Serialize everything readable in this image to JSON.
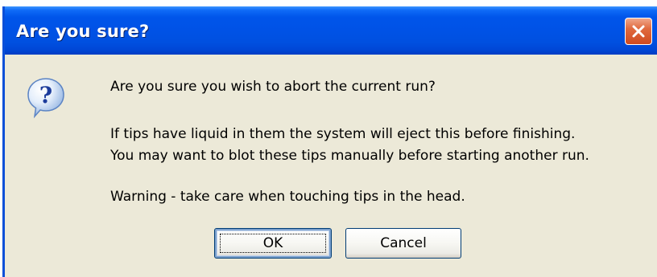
{
  "dialog": {
    "title": "Are you sure?",
    "icon": "question-icon",
    "question": "Are you sure you wish to abort the current run?",
    "info_line_1": "If tips have liquid in them the system will eject this before finishing.",
    "info_line_2": "You may want to blot these tips manually before starting another run.",
    "warning": "Warning - take care when touching tips in the head.",
    "ok_label": "OK",
    "cancel_label": "Cancel"
  },
  "colors": {
    "titlebar": "#0055ea",
    "dialog_bg": "#ece9d8",
    "close_button": "#e06a3f",
    "button_border": "#003c74"
  }
}
